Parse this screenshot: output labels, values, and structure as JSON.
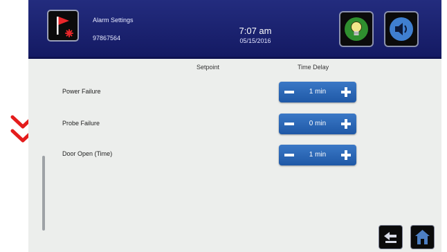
{
  "header": {
    "title": "Alarm Settings",
    "device_id": "97867564",
    "time": "7:07 am",
    "date": "05/15/2016"
  },
  "columns": {
    "setpoint": "Setpoint",
    "time_delay": "Time Delay"
  },
  "alarms": [
    {
      "label": "Power Failure",
      "time_delay": "1 min"
    },
    {
      "label": "Probe Failure",
      "time_delay": "0 min"
    },
    {
      "label": "Door Open (Time)",
      "time_delay": "1 min"
    }
  ],
  "icons": {
    "app": "alarm-flag-icon",
    "light": "light-bulb-icon",
    "sound": "speaker-icon",
    "back": "back-arrow-icon",
    "home": "home-icon",
    "annotation": "double-chevron-down-icon"
  },
  "colors": {
    "header": "#1b2270",
    "stepper": "#2b68b6",
    "annotation": "#e41c1c",
    "flag": "#e8262a",
    "bulb": "#f2e78a"
  }
}
